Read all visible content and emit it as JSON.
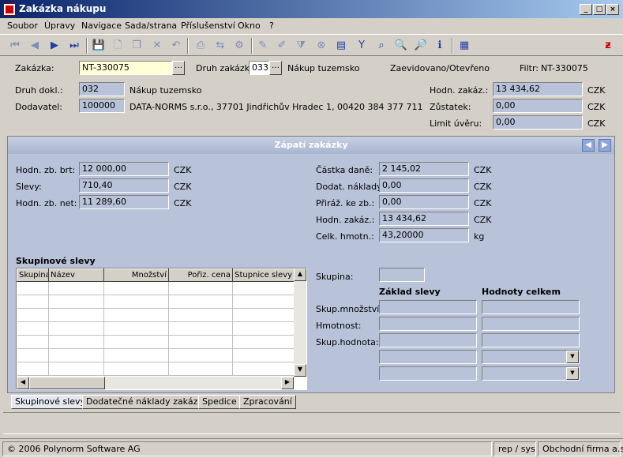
{
  "window": {
    "title": "Zakázka nákupu"
  },
  "menu": [
    "Soubor",
    "Úpravy",
    "Navigace",
    "Sada/strana",
    "Příslušenství",
    "Okno",
    "?"
  ],
  "header": {
    "zakazka_label": "Zakázka:",
    "zakazka_value": "NT-330075",
    "druh_zakazky_label": "Druh zakázk:",
    "druh_zakazky_value": "033",
    "druh_zakazky_text": "Nákup tuzemsko",
    "status": "Zaevidovano/Otevřeno",
    "filtr_label": "Filtr:",
    "filtr_value": "NT-330075",
    "druh_dokl_label": "Druh dokl.:",
    "druh_dokl_value": "032",
    "druh_dokl_text": "Nákup tuzemsko",
    "dodavatel_label": "Dodavatel:",
    "dodavatel_value": "100000",
    "dodavatel_text": "DATA-NORMS s.r.o., 37701 Jindřichův Hradec 1, 00420 384 377 711",
    "hodn_zakaz_label": "Hodn. zakáz.:",
    "hodn_zakaz_value": "13 434,62",
    "hodn_zakaz_cur": "CZK",
    "zustatek_label": "Zůstatek:",
    "zustatek_value": "0,00",
    "zustatek_cur": "CZK",
    "limit_label": "Limit úvěru:",
    "limit_value": "0,00",
    "limit_cur": "CZK"
  },
  "footer_panel": {
    "title": "Zápatí zakázky",
    "left": [
      {
        "label": "Hodn. zb. brt:",
        "value": "12 000,00",
        "unit": "CZK"
      },
      {
        "label": "Slevy:",
        "value": "710,40",
        "unit": "CZK"
      },
      {
        "label": "Hodn. zb. net:",
        "value": "11 289,60",
        "unit": "CZK"
      }
    ],
    "right": [
      {
        "label": "Částka daně:",
        "value": "2 145,02",
        "unit": "CZK"
      },
      {
        "label": "Dodat. náklady:",
        "value": "0,00",
        "unit": "CZK"
      },
      {
        "label": "Přiráž. ke zb.:",
        "value": "0,00",
        "unit": "CZK"
      },
      {
        "label": "Hodn. zakáz.:",
        "value": "13 434,62",
        "unit": "CZK"
      },
      {
        "label": "Celk. hmotn.:",
        "value": "43,20000",
        "unit": "kg"
      }
    ],
    "group_title": "Skupinové slevy",
    "grid_columns": [
      "Skupina",
      "Název",
      "Množství",
      "Pořiz. cena",
      "Stupnice slevy"
    ],
    "skupina_label": "Skupina:",
    "zaklad_header": "Základ slevy",
    "hodnoty_header": "Hodnoty celkem",
    "detail_rows": [
      "Skup.množství:",
      "Hmotnost:",
      "Skup.hodnota:"
    ]
  },
  "tabs": [
    "Skupinové slevy",
    "Dodatečné náklady zakázky",
    "Spedice",
    "Zpracování"
  ],
  "status": {
    "copyright": "© 2006 Polynorm Software AG",
    "user": "rep / sys",
    "company": "Obchodní firma a.s."
  }
}
